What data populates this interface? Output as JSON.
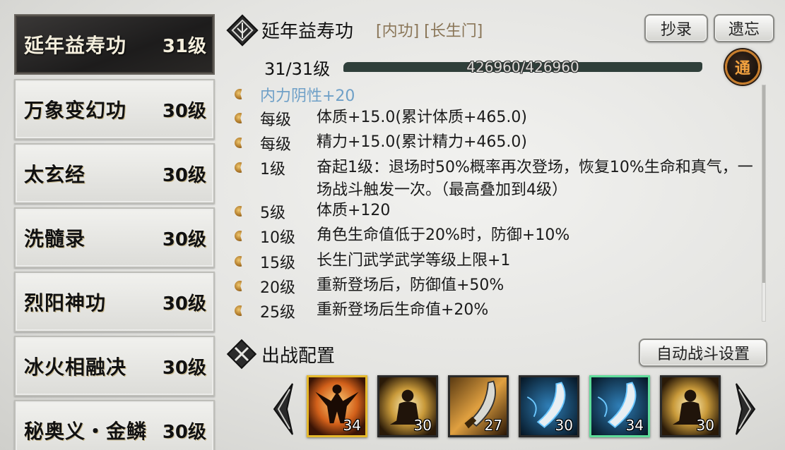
{
  "skills": [
    {
      "name": "延年益寿功",
      "level": "31级"
    },
    {
      "name": "万象变幻功",
      "level": "30级"
    },
    {
      "name": "太玄经",
      "level": "30级"
    },
    {
      "name": "洗髓录",
      "level": "30级"
    },
    {
      "name": "烈阳神功",
      "level": "30级"
    },
    {
      "name": "冰火相融决",
      "level": "30级"
    },
    {
      "name": "秘奥义・金鳞",
      "level": "30级"
    }
  ],
  "detail": {
    "title": "延年益寿功",
    "tags": "[内功] [长生门]",
    "copy_label": "抄录",
    "forget_label": "遗忘",
    "level_text": "31/31级",
    "exp_text": "426960/426960",
    "exp_fraction": 1.0,
    "tong_badge": "通",
    "effects": [
      {
        "key": "内力阴性+20",
        "value": ""
      },
      {
        "key": "每级",
        "value": "体质+15.0(累计体质+465.0)"
      },
      {
        "key": "每级",
        "value": "精力+15.0(累计精力+465.0)"
      },
      {
        "key": "1级",
        "value": "奋起1级：退场时50%概率再次登场，恢复10%生命和真气，一场战斗触发一次。（最高叠加到4级）"
      },
      {
        "key": "5级",
        "value": "体质+120"
      },
      {
        "key": "10级",
        "value": "角色生命值低于20%时，防御+10%"
      },
      {
        "key": "15级",
        "value": "长生门武学武学等级上限+1"
      },
      {
        "key": "20级",
        "value": "重新登场后，防御值+50%"
      },
      {
        "key": "25级",
        "value": "重新登场后生命值+20%"
      }
    ]
  },
  "battle": {
    "title": "出战配置",
    "auto_label": "自动战斗设置",
    "slots": [
      {
        "count": "34",
        "icon": "monk-leap-icon",
        "frame": "gold"
      },
      {
        "count": "30",
        "icon": "meditating-figure-icon",
        "frame": "dark"
      },
      {
        "count": "27",
        "icon": "golden-blade-icon",
        "frame": "dark"
      },
      {
        "count": "30",
        "icon": "blue-blade-icon",
        "frame": "dark"
      },
      {
        "count": "34",
        "icon": "blue-blade-icon",
        "frame": "green"
      },
      {
        "count": "30",
        "icon": "meditating-figure-icon",
        "frame": "dark"
      }
    ]
  },
  "colors": {
    "accent_brown": "#8a7658",
    "effect_blue": "#6fa0c7",
    "badge_orange": "#f3a23f"
  }
}
